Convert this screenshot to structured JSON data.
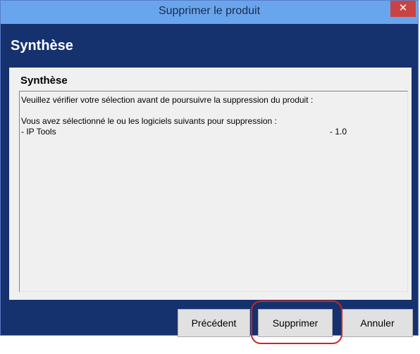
{
  "window": {
    "title": "Supprimer le produit",
    "close_label": "✕"
  },
  "header": {
    "title": "Synthèse"
  },
  "content": {
    "title": "Synthèse",
    "lines": [
      "Veuillez vérifier votre sélection avant de poursuivre la suppression du produit :",
      "",
      "Vous avez sélectionné le ou les logiciels suivants pour suppression :",
      "- IP Tools"
    ],
    "product_version": "- 1.0"
  },
  "buttons": {
    "previous": "Précédent",
    "delete": "Supprimer",
    "cancel": "Annuler"
  },
  "colors": {
    "titlebar": "#69a5ed",
    "band": "#15316e",
    "close": "#c94343",
    "highlight": "#d0231f"
  }
}
